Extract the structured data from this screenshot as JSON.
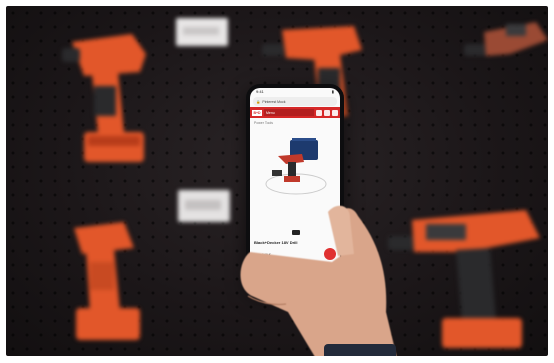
{
  "scene": {
    "description_colors": {
      "wall": "#1c1719",
      "drill_orange": "#e2572a",
      "drill_black": "#2a2a2c",
      "brand_red": "#d62828"
    }
  },
  "phone": {
    "status_time": "9:41",
    "url_text": "Pinterest Mock",
    "menu_label": "Menu",
    "logo_text": "B+D",
    "crumb_text": "Power Tools",
    "product_title": "Black+Decker 18V Drill",
    "product_price": "from 149 €"
  },
  "icons": [
    "search-icon",
    "cart-icon",
    "user-icon",
    "share-icon",
    "cube-icon"
  ]
}
